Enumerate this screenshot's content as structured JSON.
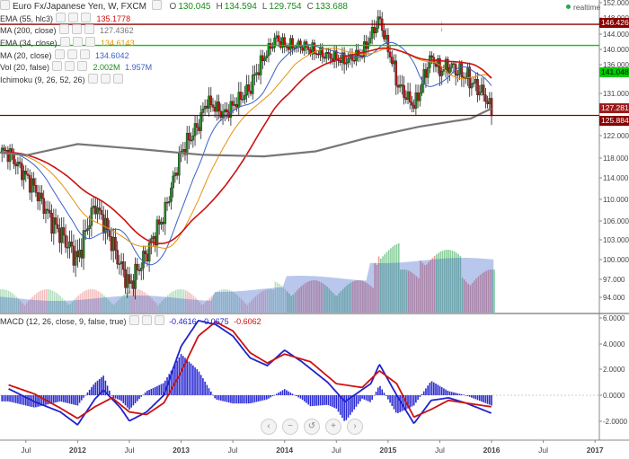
{
  "header": {
    "title": "Euro Fx/Japanese Yen, W, FXCM",
    "ohlc": [
      {
        "label": "O",
        "value": "130.045"
      },
      {
        "label": "H",
        "value": "134.594"
      },
      {
        "label": "L",
        "value": "129.754"
      },
      {
        "label": "C",
        "value": "133.688"
      }
    ],
    "realtime_label": "realtime"
  },
  "legend": [
    {
      "label": "EMA (55, hlc3)",
      "value": "135.1778",
      "value2": "",
      "color": "#cc1111"
    },
    {
      "label": "MA (200, close)",
      "value": "127.4362",
      "value2": "",
      "color": "#777777"
    },
    {
      "label": "EMA (34, close)",
      "value": "134.6143",
      "value2": "",
      "color": "#e8900c"
    },
    {
      "label": "MA (20, close)",
      "value": "134.6042",
      "value2": "",
      "color": "#3a5fc8"
    },
    {
      "label": "Vol (20, false)",
      "value": "2.002M",
      "value2": "1.957M",
      "color": "#1a8c1a"
    },
    {
      "label": "Ichimoku (9, 26, 52, 26)",
      "value": "",
      "value2": "",
      "color": "#555555"
    }
  ],
  "price_boxes": [
    {
      "value": "146.426",
      "color": "#8b0000"
    },
    {
      "value": "141.048",
      "color": "#00cc00"
    },
    {
      "value": "127.281",
      "color": "#9c1c1c"
    },
    {
      "value": "125.884",
      "color": "#8b0000"
    }
  ],
  "macd_legend": {
    "label": "MACD (12, 26, close, 9, false, true)",
    "values": [
      {
        "v": "-0.4616",
        "color": "#2222cc"
      },
      {
        "v": "-0.0675",
        "color": "#2222cc"
      },
      {
        "v": "-0.6062",
        "color": "#cc1111"
      }
    ]
  },
  "nav_buttons": [
    "‹",
    "−",
    "↺",
    "+",
    "›"
  ],
  "colors": {
    "up": "#1a8c1a",
    "down": "#cc1111",
    "support": "#8b0000",
    "resistance": "#00cc00"
  },
  "chart_data": [
    {
      "type": "candlestick",
      "title": "Euro Fx/Japanese Yen, W, FXCM",
      "x_tick_labels": [
        "Jul",
        "2012",
        "Jul",
        "2013",
        "Jul",
        "2014",
        "Jul",
        "2015",
        "Jul",
        "2016",
        "Jul",
        "2017"
      ],
      "y_tick_labels": [
        "152.000",
        "148.000",
        "144.000",
        "140.000",
        "136.000",
        "131.000",
        "127.000",
        "122.000",
        "118.000",
        "114.000",
        "110.000",
        "106.000",
        "103.000",
        "100.000",
        "97.000",
        "94.000"
      ],
      "ylim": [
        92,
        152
      ],
      "horizontal_lines": [
        146.426,
        141.048,
        125.884
      ],
      "close_path": [
        {
          "date": "2011-05",
          "close": 119
        },
        {
          "date": "2011-08",
          "close": 112
        },
        {
          "date": "2011-10",
          "close": 106
        },
        {
          "date": "2011-11",
          "close": 104
        },
        {
          "date": "2012-01",
          "close": 100
        },
        {
          "date": "2012-03",
          "close": 109
        },
        {
          "date": "2012-04",
          "close": 106
        },
        {
          "date": "2012-06",
          "close": 99
        },
        {
          "date": "2012-07",
          "close": 96
        },
        {
          "date": "2012-09",
          "close": 101
        },
        {
          "date": "2012-11",
          "close": 107
        },
        {
          "date": "2013-01",
          "close": 119
        },
        {
          "date": "2013-03",
          "close": 124
        },
        {
          "date": "2013-04",
          "close": 129
        },
        {
          "date": "2013-06",
          "close": 126
        },
        {
          "date": "2013-09",
          "close": 132
        },
        {
          "date": "2013-12",
          "close": 143
        },
        {
          "date": "2014-01",
          "close": 141
        },
        {
          "date": "2014-03",
          "close": 141
        },
        {
          "date": "2014-05",
          "close": 139
        },
        {
          "date": "2014-08",
          "close": 137
        },
        {
          "date": "2014-10",
          "close": 139
        },
        {
          "date": "2014-12",
          "close": 148
        },
        {
          "date": "2015-01",
          "close": 140
        },
        {
          "date": "2015-02",
          "close": 133
        },
        {
          "date": "2015-04",
          "close": 128
        },
        {
          "date": "2015-06",
          "close": 138
        },
        {
          "date": "2015-07",
          "close": 135
        },
        {
          "date": "2015-08",
          "close": 136
        },
        {
          "date": "2015-10",
          "close": 134
        },
        {
          "date": "2015-12",
          "close": 131
        },
        {
          "date": "2016-01",
          "close": 127
        }
      ]
    },
    {
      "type": "line",
      "title": "MACD (12, 26, close, 9, false, true)",
      "y_tick_labels": [
        "6.0000",
        "4.0000",
        "2.0000",
        "0.0000",
        "-2.0000"
      ],
      "ylim": [
        -3.2,
        6.0
      ],
      "series": [
        {
          "name": "MACD",
          "color": "#2222cc",
          "points": [
            {
              "date": "2011-05",
              "v": 0.5
            },
            {
              "date": "2011-08",
              "v": -0.5
            },
            {
              "date": "2011-11",
              "v": -1.3
            },
            {
              "date": "2012-01",
              "v": -2.3
            },
            {
              "date": "2012-03",
              "v": -0.3
            },
            {
              "date": "2012-04",
              "v": 0.4
            },
            {
              "date": "2012-06",
              "v": -1.0
            },
            {
              "date": "2012-07",
              "v": -2.0
            },
            {
              "date": "2012-09",
              "v": -1.3
            },
            {
              "date": "2012-11",
              "v": 0.0
            },
            {
              "date": "2013-01",
              "v": 3.8
            },
            {
              "date": "2013-03",
              "v": 5.8
            },
            {
              "date": "2013-05",
              "v": 5.5
            },
            {
              "date": "2013-07",
              "v": 4.6
            },
            {
              "date": "2013-09",
              "v": 2.9
            },
            {
              "date": "2013-11",
              "v": 2.3
            },
            {
              "date": "2014-01",
              "v": 3.5
            },
            {
              "date": "2014-03",
              "v": 2.6
            },
            {
              "date": "2014-06",
              "v": 1.0
            },
            {
              "date": "2014-08",
              "v": -0.5
            },
            {
              "date": "2014-11",
              "v": 0.9
            },
            {
              "date": "2014-12",
              "v": 2.4
            },
            {
              "date": "2015-02",
              "v": 0.0
            },
            {
              "date": "2015-04",
              "v": -2.2
            },
            {
              "date": "2015-06",
              "v": -0.4
            },
            {
              "date": "2015-08",
              "v": -0.2
            },
            {
              "date": "2015-10",
              "v": -0.6
            },
            {
              "date": "2016-01",
              "v": -1.4
            }
          ]
        },
        {
          "name": "Signal",
          "color": "#cc1111",
          "points": [
            {
              "date": "2011-05",
              "v": 0.8
            },
            {
              "date": "2011-08",
              "v": 0.1
            },
            {
              "date": "2011-11",
              "v": -1.0
            },
            {
              "date": "2012-01",
              "v": -1.8
            },
            {
              "date": "2012-03",
              "v": -0.9
            },
            {
              "date": "2012-05",
              "v": -0.2
            },
            {
              "date": "2012-07",
              "v": -1.3
            },
            {
              "date": "2012-09",
              "v": -1.5
            },
            {
              "date": "2012-11",
              "v": -0.6
            },
            {
              "date": "2013-01",
              "v": 1.8
            },
            {
              "date": "2013-03",
              "v": 4.6
            },
            {
              "date": "2013-05",
              "v": 5.7
            },
            {
              "date": "2013-07",
              "v": 5.0
            },
            {
              "date": "2013-09",
              "v": 3.3
            },
            {
              "date": "2013-11",
              "v": 2.5
            },
            {
              "date": "2014-01",
              "v": 3.2
            },
            {
              "date": "2014-04",
              "v": 2.6
            },
            {
              "date": "2014-07",
              "v": 0.9
            },
            {
              "date": "2014-10",
              "v": 0.6
            },
            {
              "date": "2014-12",
              "v": 1.9
            },
            {
              "date": "2015-02",
              "v": 0.9
            },
            {
              "date": "2015-04",
              "v": -1.7
            },
            {
              "date": "2015-06",
              "v": -1.1
            },
            {
              "date": "2015-08",
              "v": -0.4
            },
            {
              "date": "2015-10",
              "v": -0.6
            },
            {
              "date": "2016-01",
              "v": -0.9
            }
          ]
        }
      ],
      "x_tick_labels": [
        "Jul",
        "2012",
        "Jul",
        "2013",
        "Jul",
        "2014",
        "Jul",
        "2015",
        "Jul",
        "2016",
        "Jul",
        "2017"
      ]
    }
  ]
}
